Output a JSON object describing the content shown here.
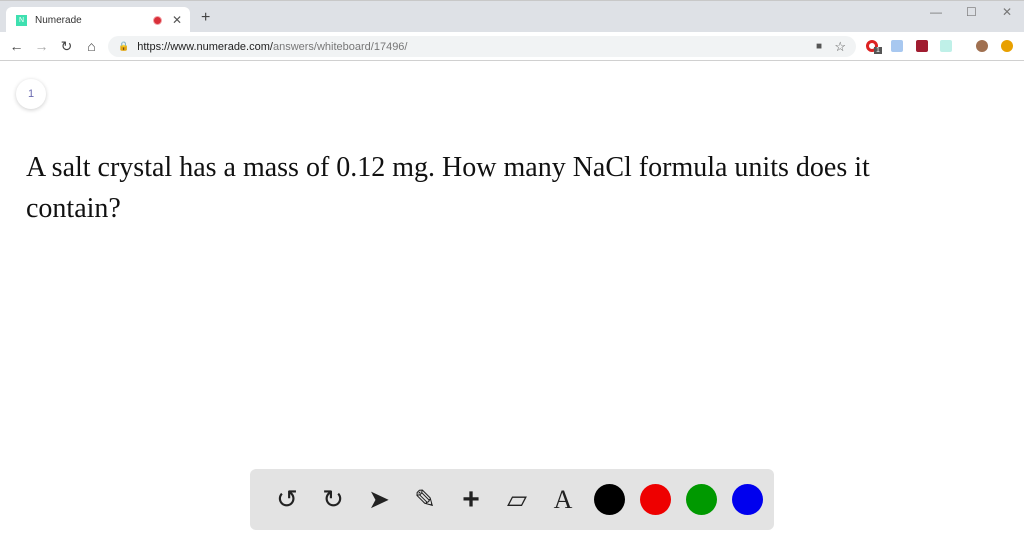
{
  "browser": {
    "tab_title": "Numerade",
    "favicon_letter": "N",
    "url_host": "https://www.numerade.com/",
    "url_path": "answers/whiteboard/17496/",
    "ext_badge": "1"
  },
  "page": {
    "page_number": "1",
    "question": "A salt crystal has a mass of 0.12 mg. How many NaCl formula units does it contain?"
  },
  "toolbar": {
    "text_tool": "A",
    "colors": [
      "#000000",
      "#ee0000",
      "#009900",
      "#0000ee"
    ]
  }
}
